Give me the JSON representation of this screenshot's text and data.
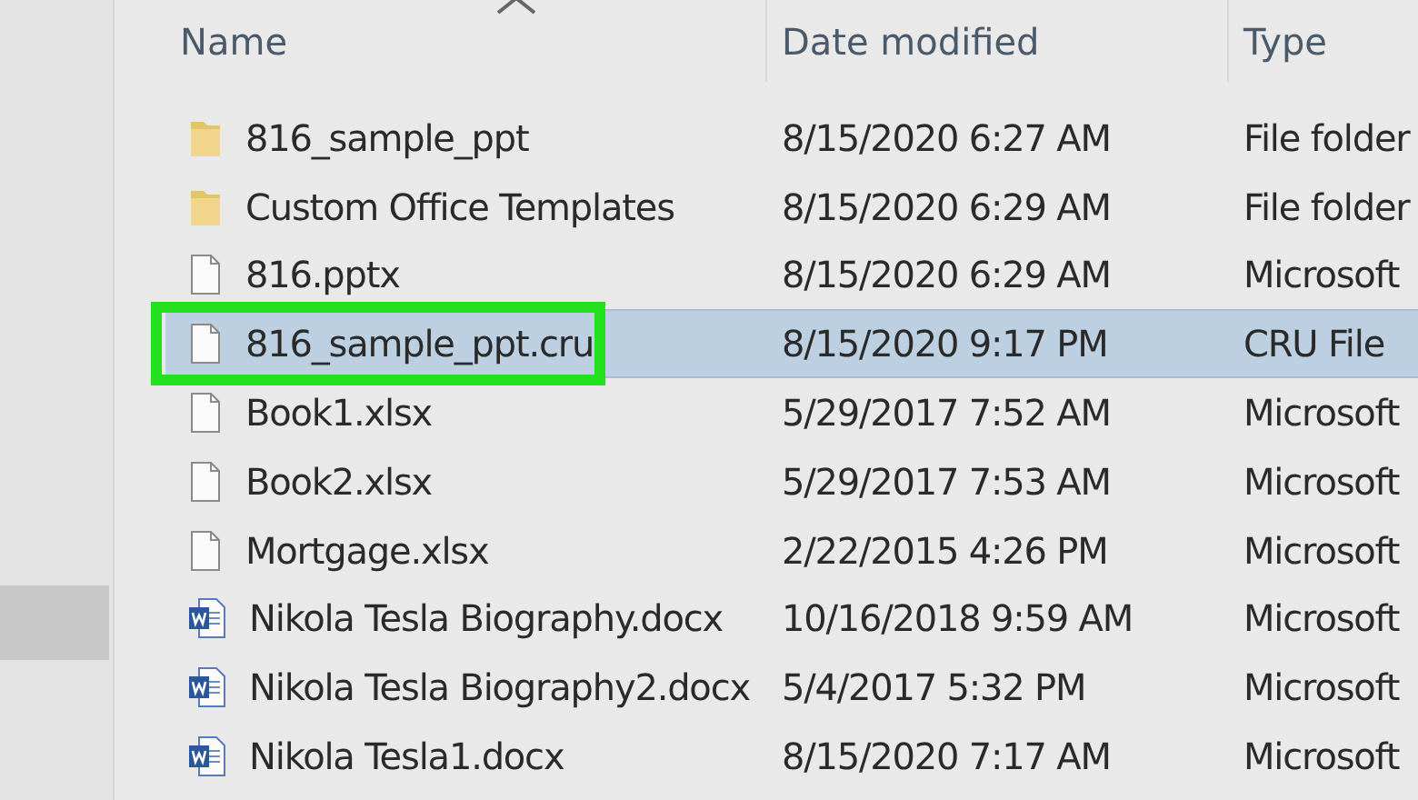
{
  "columns": [
    "Name",
    "Date modified",
    "Type"
  ],
  "rows": [
    {
      "kind": "folder",
      "name": "816_sample_ppt",
      "date": "8/15/2020 6:27 AM",
      "type": "File folder",
      "selected": false
    },
    {
      "kind": "folder",
      "name": "Custom Office Templates",
      "date": "8/15/2020 6:29 AM",
      "type": "File folder",
      "selected": false
    },
    {
      "kind": "file",
      "name": "816.pptx",
      "date": "8/15/2020 6:29 AM",
      "type": "Microsoft",
      "selected": false
    },
    {
      "kind": "file",
      "name": "816_sample_ppt.cru",
      "date": "8/15/2020 9:17 PM",
      "type": "CRU File",
      "selected": true
    },
    {
      "kind": "file",
      "name": "Book1.xlsx",
      "date": "5/29/2017 7:52 AM",
      "type": "Microsoft",
      "selected": false
    },
    {
      "kind": "file",
      "name": "Book2.xlsx",
      "date": "5/29/2017 7:53 AM",
      "type": "Microsoft",
      "selected": false
    },
    {
      "kind": "file",
      "name": "Mortgage.xlsx",
      "date": "2/22/2015 4:26 PM",
      "type": "Microsoft",
      "selected": false
    },
    {
      "kind": "word",
      "name": "Nikola Tesla Biography.docx",
      "date": "10/16/2018 9:59 AM",
      "type": "Microsoft",
      "selected": false
    },
    {
      "kind": "word",
      "name": "Nikola Tesla Biography2.docx",
      "date": "5/4/2017 5:32 PM",
      "type": "Microsoft",
      "selected": false
    },
    {
      "kind": "word",
      "name": "Nikola Tesla1.docx",
      "date": "8/15/2020 7:17 AM",
      "type": "Microsoft",
      "selected": false
    }
  ]
}
